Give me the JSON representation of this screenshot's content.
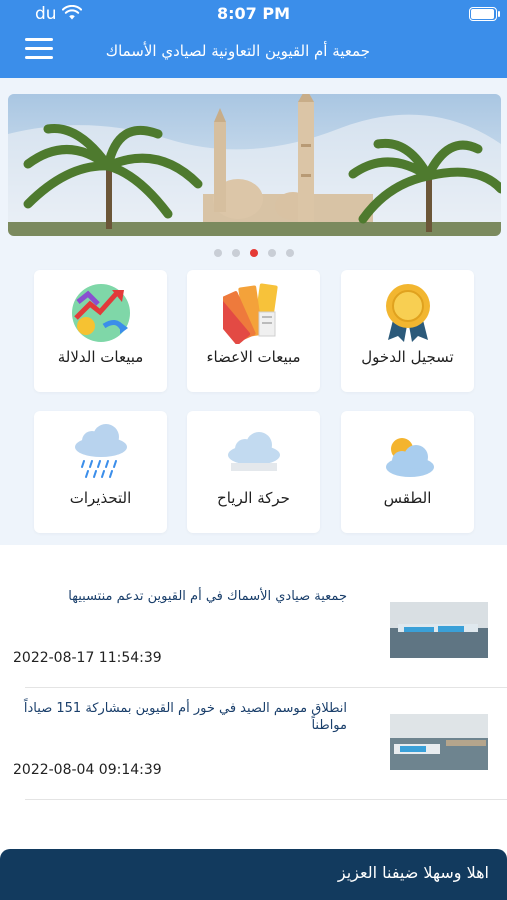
{
  "status_bar": {
    "carrier": "du",
    "time": "8:07 PM"
  },
  "header": {
    "title": "جمعية أم القيوين التعاونية لصيادي الأسماك",
    "menu_icon": "hamburger-icon"
  },
  "banner": {
    "image": "mosque-with-palm-trees",
    "slide_count": 5,
    "active_slide": 3
  },
  "tiles": [
    {
      "label": "تسجيل الدخول",
      "icon": "medal-icon"
    },
    {
      "label": "مبيعات الاعضاء",
      "icon": "color-palette-icon"
    },
    {
      "label": "مبيعات الدلالة",
      "icon": "sales-chart-icon"
    },
    {
      "label": "الطقس",
      "icon": "sun-cloud-icon"
    },
    {
      "label": "حركة الرياح",
      "icon": "wind-cloud-icon"
    },
    {
      "label": "التحذيرات",
      "icon": "rain-cloud-icon"
    }
  ],
  "news": [
    {
      "title": "جمعية صيادي الأسماك في أم القيوين تدعم منتسبيها",
      "date": "2022-08-17 11:54:39"
    },
    {
      "title": "انطلاق موسم الصيد في خور أم القيوين بمشاركة 151 صياداً مواطناً",
      "date": "2022-08-04 09:14:39"
    }
  ],
  "footer": {
    "welcome": "اهلا وسهلا ضيفنا العزيز"
  },
  "colors": {
    "header_blue": "#3b8eea",
    "section_bg": "#eef4fb",
    "footer_navy": "#123a5e",
    "active_dot": "#e53935"
  }
}
